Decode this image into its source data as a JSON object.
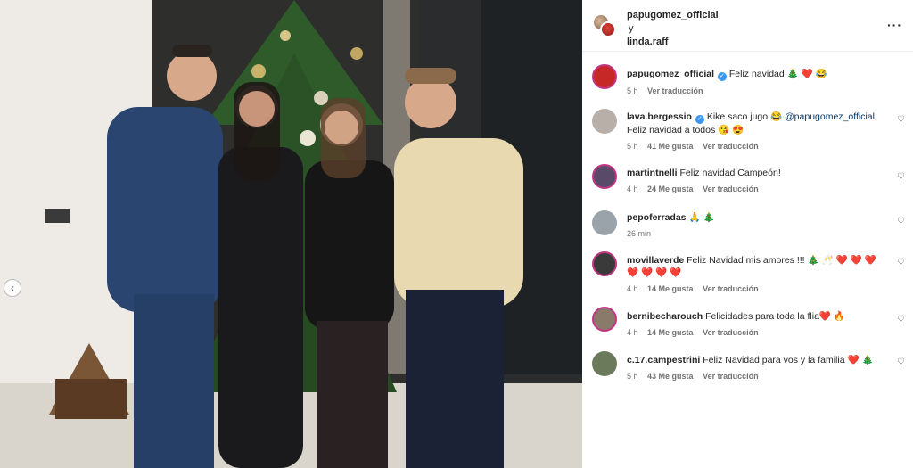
{
  "header": {
    "user1": "papugomez_official",
    "joiner": "y",
    "user2": "linda.raff"
  },
  "comments": [
    {
      "user": "papugomez_official",
      "verified": true,
      "text": "Feliz navidad 🎄 ❤️ 😂",
      "time": "5 h",
      "likes": "",
      "translate": "Ver traducción",
      "avatar_color": "#c62828",
      "ring": true,
      "caption": true
    },
    {
      "user": "lava.bergessio",
      "verified": true,
      "text_pre": "Kike saco jugo 😂 ",
      "mention": "@papugomez_official",
      "text_post": " Feliz navidad a todos 😘 😍",
      "time": "5 h",
      "likes": "41 Me gusta",
      "translate": "Ver traducción",
      "avatar_color": "#b8b0a8",
      "ring": false
    },
    {
      "user": "martintnelli",
      "verified": false,
      "text": "Feliz navidad Campeón!",
      "time": "4 h",
      "likes": "24 Me gusta",
      "translate": "Ver traducción",
      "avatar_color": "#5a4a6a",
      "ring": true
    },
    {
      "user": "pepoferradas",
      "verified": false,
      "text": "🙏 🎄",
      "time": "26 min",
      "likes": "",
      "translate": "",
      "avatar_color": "#9aa3aa",
      "ring": false
    },
    {
      "user": "movillaverde",
      "verified": false,
      "text": "Feliz Navidad mis amores !!! 🎄 🥂 ❤️ ❤️ ❤️ ❤️ ❤️ ❤️ ❤️",
      "time": "4 h",
      "likes": "14 Me gusta",
      "translate": "Ver traducción",
      "avatar_color": "#3a3a3a",
      "ring": true
    },
    {
      "user": "bernibecharouch",
      "verified": false,
      "text": "Felicidades para toda la flia❤️ 🔥",
      "time": "4 h",
      "likes": "14 Me gusta",
      "translate": "Ver traducción",
      "avatar_color": "#8a7a6a",
      "ring": true
    },
    {
      "user": "c.17.campestrini",
      "verified": false,
      "text": "Feliz Navidad para vos y la familia ❤️ 🎄",
      "time": "5 h",
      "likes": "43 Me gusta",
      "translate": "Ver traducción",
      "avatar_color": "#6b7a5a",
      "ring": false
    }
  ],
  "icons": {
    "more": "more-options-icon",
    "heart": "heart-icon",
    "carousel_prev": "chevron-left-icon",
    "verified": "verified-badge-icon"
  },
  "colors": {
    "verified": "#3897f0",
    "mention": "#00376b",
    "meta": "#737373"
  }
}
